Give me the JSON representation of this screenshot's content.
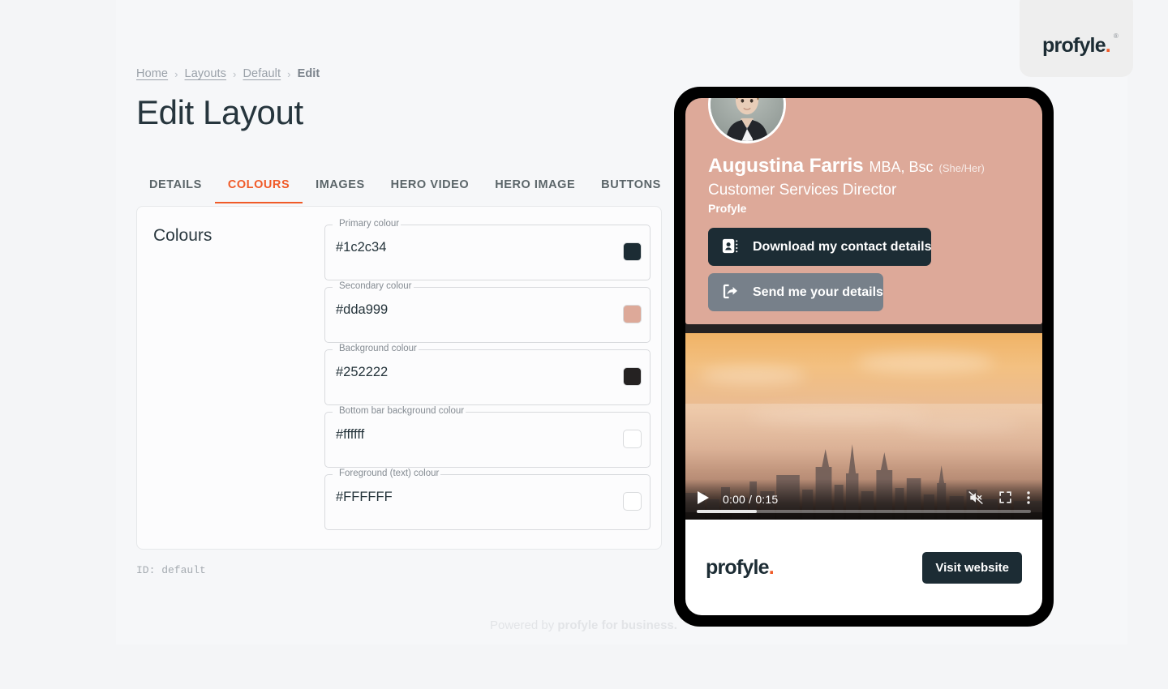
{
  "brand": {
    "logo_text": "profyle",
    "logo_dot": ".",
    "registered_mark": "®",
    "accent_color": "#f05a28",
    "dark_color": "#1c2c34"
  },
  "breadcrumb": {
    "items": [
      {
        "label": "Home",
        "current": false
      },
      {
        "label": "Layouts",
        "current": false
      },
      {
        "label": "Default",
        "current": false
      },
      {
        "label": "Edit",
        "current": true
      }
    ],
    "separator": "›"
  },
  "page": {
    "title": "Edit Layout",
    "id_line": "ID: default",
    "powered_prefix": "Powered by ",
    "powered_brand": "profyle for business."
  },
  "tabs": [
    {
      "label": "DETAILS",
      "active": false
    },
    {
      "label": "COLOURS",
      "active": true
    },
    {
      "label": "IMAGES",
      "active": false
    },
    {
      "label": "HERO VIDEO",
      "active": false
    },
    {
      "label": "HERO IMAGE",
      "active": false
    },
    {
      "label": "BUTTONS",
      "active": false
    }
  ],
  "colours_card": {
    "heading": "Colours",
    "fields": [
      {
        "label": "Primary colour",
        "value": "#1c2c34",
        "placeholder": "#000000",
        "swatch": "#1c2c34"
      },
      {
        "label": "Secondary colour",
        "value": "#dda999",
        "placeholder": "#000000",
        "swatch": "#dda999"
      },
      {
        "label": "Background colour",
        "value": "#252222",
        "placeholder": "#000000",
        "swatch": "#252222"
      },
      {
        "label": "Bottom bar background colour",
        "value": "#ffffff",
        "placeholder": "#000000",
        "swatch": "#ffffff"
      },
      {
        "label": "Foreground (text) colour",
        "value": "#FFFFFF",
        "placeholder": "#000000",
        "swatch": "#ffffff"
      }
    ]
  },
  "preview": {
    "hero_background": "#dda999",
    "screen_background": "#252222",
    "person": {
      "name": "Augustina Farris",
      "qualifications": "MBA, Bsc",
      "pronouns": "(She/Her)",
      "role": "Customer Services Director",
      "company": "Profyle"
    },
    "cta_buttons": [
      {
        "label": "Download my contact details",
        "icon": "contact-card-icon",
        "background": "#1c2c34"
      },
      {
        "label": "Send me your details",
        "icon": "share-out-icon",
        "background": "#77808a"
      }
    ],
    "video": {
      "current_time": "0:00",
      "duration": "0:15",
      "time_display": "0:00 / 0:15",
      "progress_percent": 18,
      "muted": true,
      "controls": [
        "play-icon",
        "mute-icon",
        "fullscreen-icon",
        "more-options-icon"
      ]
    },
    "bottom_bar": {
      "logo_text": "profyle",
      "logo_dot": ".",
      "button_label": "Visit website",
      "background": "#ffffff"
    }
  }
}
